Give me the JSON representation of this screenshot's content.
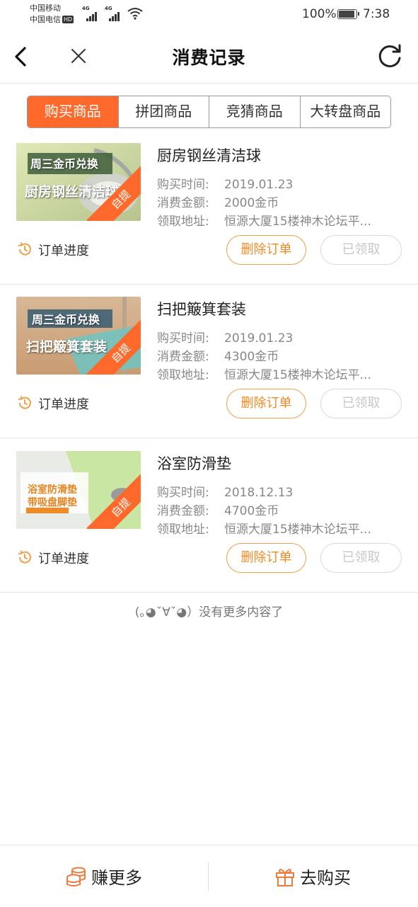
{
  "status_bar": {
    "carrier1": "中国移动",
    "carrier2": "中国电信",
    "hd": "HD",
    "net1": "4G",
    "net2": "4G",
    "battery": "100%",
    "time": "7:38"
  },
  "nav": {
    "title": "消费记录"
  },
  "tabs": [
    {
      "label": "购买商品",
      "active": true
    },
    {
      "label": "拼团商品",
      "active": false
    },
    {
      "label": "竞猜商品",
      "active": false
    },
    {
      "label": "大转盘商品",
      "active": false
    }
  ],
  "labels": {
    "time": "购买时间:",
    "amount": "消费金额:",
    "address": "领取地址:",
    "progress": "订单进度",
    "delete": "删除订单",
    "received": "已领取",
    "ribbon": "自提"
  },
  "orders": [
    {
      "title": "厨房钢丝清洁球",
      "time": "2019.01.23",
      "amount": "2000金币",
      "address": "恒源大厦15楼神木论坛平...",
      "thumb_caption_top": "周三金币兑换",
      "thumb_caption_main": "厨房钢丝清洁球"
    },
    {
      "title": "扫把簸箕套装",
      "time": "2019.01.23",
      "amount": "4300金币",
      "address": "恒源大厦15楼神木论坛平...",
      "thumb_caption_top": "周三金币兑换",
      "thumb_caption_main": "扫把簸箕套装"
    },
    {
      "title": "浴室防滑垫",
      "time": "2018.12.13",
      "amount": "4700金币",
      "address": "恒源大厦15楼神木论坛平...",
      "thumb_caption_top": "浴室防滑垫",
      "thumb_caption_main": "带吸盘脚垫"
    }
  ],
  "footer_note": "(｡◕ˇ∀ˇ◕）没有更多内容了",
  "bottom_bar": {
    "earn": "赚更多",
    "buy": "去购买"
  },
  "colors": {
    "accent": "#ff6a2c",
    "button_orange": "#f08a24",
    "disabled": "#c8c8c8"
  }
}
